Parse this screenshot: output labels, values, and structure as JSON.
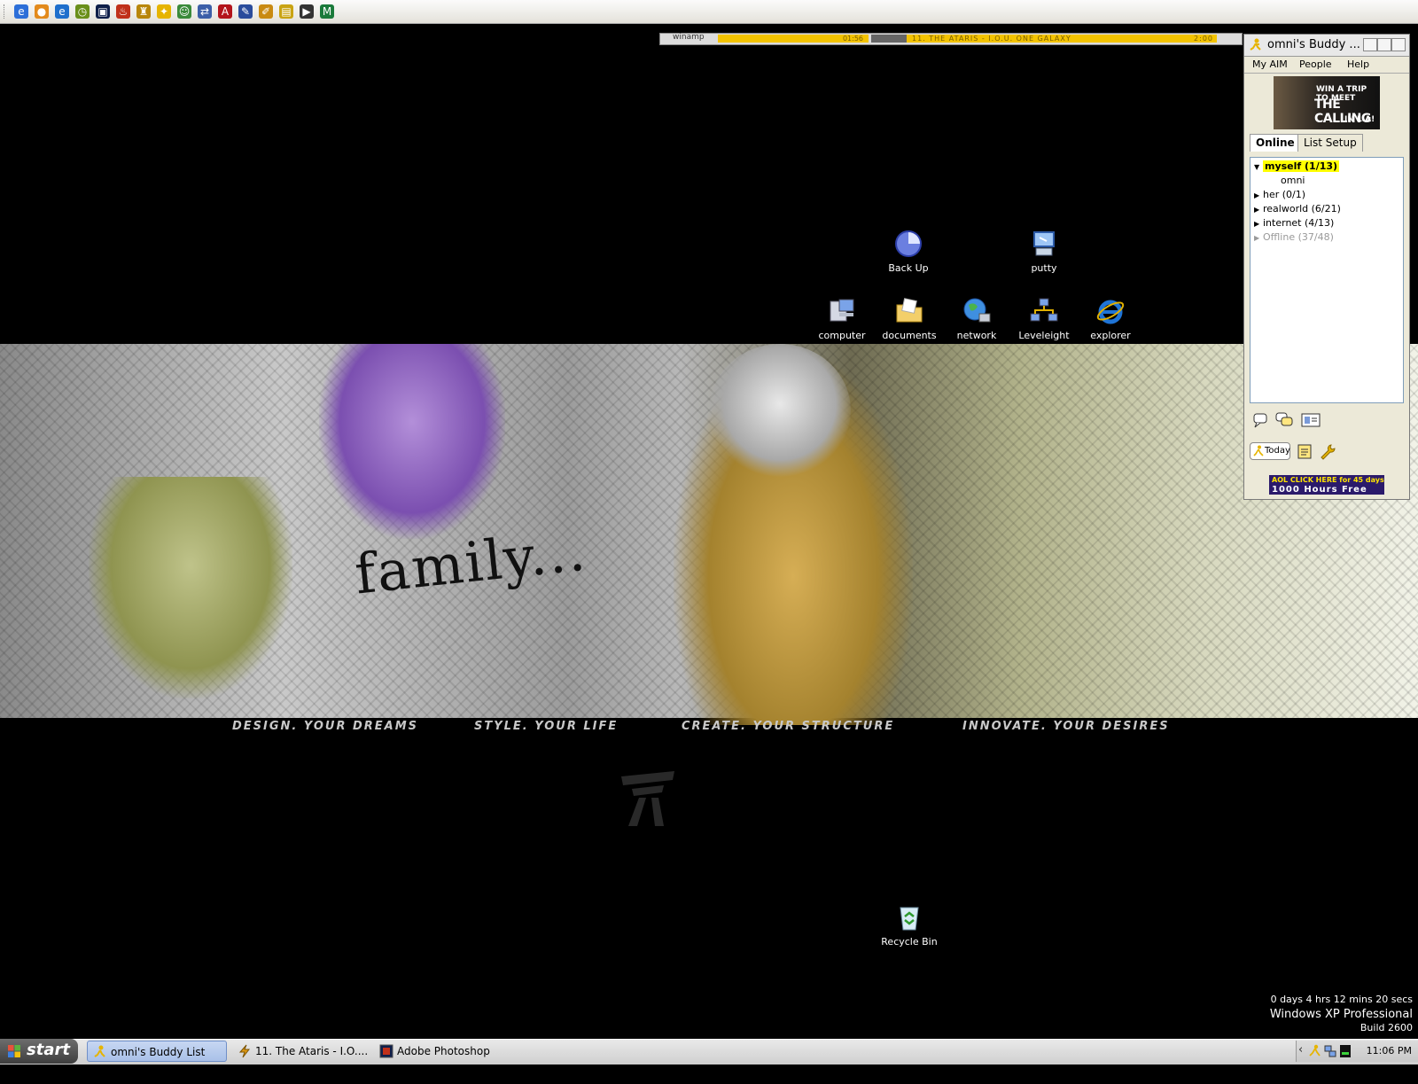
{
  "quick_launch": {
    "icons": [
      {
        "name": "ie-icon",
        "color": "#2d6fd8",
        "glyph": "e"
      },
      {
        "name": "firefox-icon",
        "color": "#e38a1c",
        "glyph": "●"
      },
      {
        "name": "browser-icon",
        "color": "#1f6fcc",
        "glyph": "e"
      },
      {
        "name": "clock-icon",
        "color": "#6a8f1a",
        "glyph": "◷"
      },
      {
        "name": "photoshop-icon",
        "color": "#0f1f4a",
        "glyph": "▣"
      },
      {
        "name": "flame-icon",
        "color": "#c0301a",
        "glyph": "♨"
      },
      {
        "name": "trophy-icon",
        "color": "#b8860b",
        "glyph": "♜"
      },
      {
        "name": "aim-runner-icon",
        "color": "#e6b400",
        "glyph": "✦"
      },
      {
        "name": "messenger-icon",
        "color": "#3a8a3a",
        "glyph": "☺"
      },
      {
        "name": "network-tool-icon",
        "color": "#3c5fa8",
        "glyph": "⇄"
      },
      {
        "name": "acrobat-icon",
        "color": "#b3141b",
        "glyph": "A"
      },
      {
        "name": "pencil-icon",
        "color": "#2a4c9c",
        "glyph": "✎"
      },
      {
        "name": "pen-tool-icon",
        "color": "#c98a12",
        "glyph": "✐"
      },
      {
        "name": "notes-icon",
        "color": "#c9a312",
        "glyph": "▤"
      },
      {
        "name": "media-player-icon",
        "color": "#333333",
        "glyph": "▶"
      },
      {
        "name": "m-app-icon",
        "color": "#1a7a3a",
        "glyph": "M"
      }
    ]
  },
  "winamp": {
    "title": "winamp",
    "time": "01:56",
    "marquee": "11. THE ATARIS - I.O.U. ONE GALAXY",
    "duration": "2:00"
  },
  "wallpaper": {
    "family_text": "family...",
    "slogans": [
      "DESIGN. YOUR DREAMS",
      "STYLE. YOUR LIFE",
      "CREATE. YOUR STRUCTURE",
      "INNOVATE. YOUR DESIRES"
    ]
  },
  "desktop_icons": {
    "backup": "Back Up",
    "putty": "putty",
    "computer": "computer",
    "documents": "documents",
    "network": "network",
    "leveleight": "Leveleight",
    "explorer": "explorer",
    "recycle": "Recycle Bin"
  },
  "aim": {
    "title": "omni's Buddy ...",
    "menu": [
      "My AIM",
      "People",
      "Help"
    ],
    "ad": {
      "line1": "WIN A TRIP TO MEET",
      "line2": "THE CALLING",
      "line3": "IN L.A!"
    },
    "tabs": [
      "Online",
      "List Setup"
    ],
    "groups": {
      "myself": "myself (1/13)",
      "omni": "omni",
      "her": "her (0/1)",
      "realworld": "realworld (6/21)",
      "internet": "internet (4/13)",
      "offline": "Offline (37/48)"
    },
    "today": "Today",
    "ad2": {
      "line1": "AOL CLICK HERE for 45 days",
      "line2": "1000 Hours Free"
    }
  },
  "sysinfo": {
    "uptime": "0 days 4 hrs 12 mins 20 secs",
    "os": "Windows XP Professional",
    "build": "Build 2600"
  },
  "taskbar": {
    "start": "start",
    "tasks": [
      "omni's Buddy List W...",
      "11. The Ataris - I.O....",
      "Adobe Photoshop"
    ],
    "clock": "11:06 PM"
  }
}
